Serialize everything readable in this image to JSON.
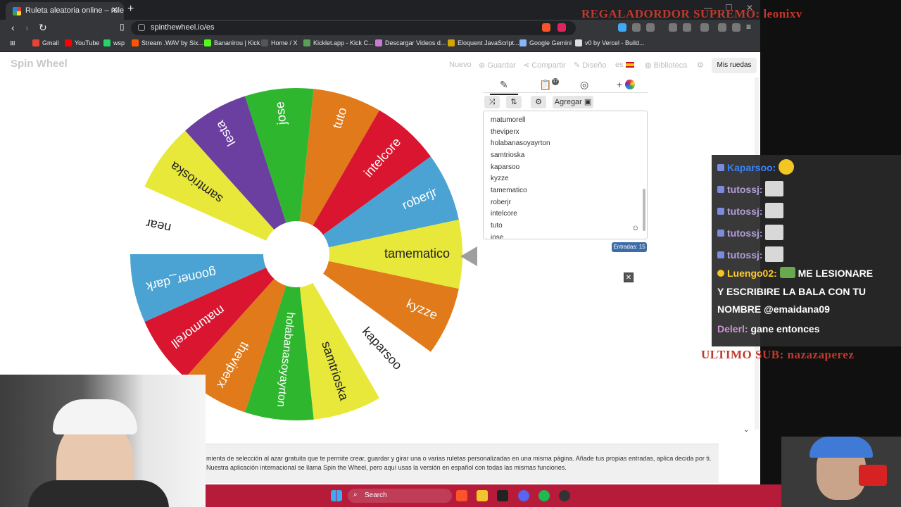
{
  "browser": {
    "tab_title": "Ruleta aleatoria online – ruleta d",
    "url": "spinthewheel.io/es",
    "bookmarks": [
      "Gmail",
      "YouTube",
      "wsp",
      "Stream .WAV by Six...",
      "Bananirou | Kick",
      "Home / X",
      "Kicklet.app - Kick C...",
      "Descargar Videos d...",
      "Eloquent JavaScript...",
      "Google Gemini",
      "v0 by Vercel - Build..."
    ]
  },
  "site": {
    "logo": "Spin Wheel",
    "menu": [
      "Nuevo",
      "Guardar",
      "Compartir",
      "Diseño",
      "es",
      "Biblioteca"
    ],
    "my_wheels": "Mis ruedas",
    "add_label": "Agregar",
    "entries_count": "Entradas: 15",
    "entries": [
      "matumorell",
      "theviperx",
      "holabanasoyayrton",
      "samtrioska",
      "kaparsoo",
      "kyzze",
      "tamematico",
      "roberjr",
      "intelcore",
      "tuto",
      "jose"
    ],
    "description": "mienta de selección al azar gratuita que te permite crear, guardar y girar una o varias ruletas personalizadas en una misma página. Añade tus propias entradas, aplica decida por ti. Nuestra aplicación internacional se llama Spin the Wheel, pero aquí usas la versión en español con todas las mismas funciones."
  },
  "wheel": {
    "segments": [
      {
        "label": "tamematico",
        "color": "#e8e83a"
      },
      {
        "label": "kyzze",
        "color": "#e07a1a"
      },
      {
        "label": "kaparsoo",
        "color": "#ffffff"
      },
      {
        "label": "samtrioska",
        "color": "#e8e83a"
      },
      {
        "label": "holabanasoyayrton",
        "color": "#2fb62f"
      },
      {
        "label": "theviperx",
        "color": "#e07a1a"
      },
      {
        "label": "matumorell",
        "color": "#d9152f"
      },
      {
        "label": "gooner_dark",
        "color": "#4aa3d3"
      },
      {
        "label": "near",
        "color": "#ffffff"
      },
      {
        "label": "samtrioska",
        "color": "#e8e83a"
      },
      {
        "label": "lesta",
        "color": "#6b3fa0"
      },
      {
        "label": "jose",
        "color": "#2fb62f"
      },
      {
        "label": "tuto",
        "color": "#e07a1a"
      },
      {
        "label": "intelcore",
        "color": "#d9152f"
      },
      {
        "label": "roberjr",
        "color": "#4aa3d3"
      }
    ]
  },
  "stream": {
    "banner_top": "REGALADORDOR SUPREMO: leonixv",
    "banner_bottom": "ULTIMO SUB: nazazaperez",
    "chat": [
      {
        "user": "Kaparsoo:",
        "text": ""
      },
      {
        "user": "tutossj:",
        "text": ""
      },
      {
        "user": "tutossj:",
        "text": ""
      },
      {
        "user": "tutossj:",
        "text": ""
      },
      {
        "user": "tutossj:",
        "text": ""
      },
      {
        "user": "Luengo02:",
        "text": "ME LESIONARE"
      },
      {
        "user": "",
        "text": "Y ESCRIBIRE LA BALA CON TU"
      },
      {
        "user": "",
        "text": "NOMBRE @emaidana09"
      },
      {
        "user": "Delerl:",
        "text": "gane entonces"
      }
    ]
  },
  "taskbar": {
    "search": "Search"
  }
}
